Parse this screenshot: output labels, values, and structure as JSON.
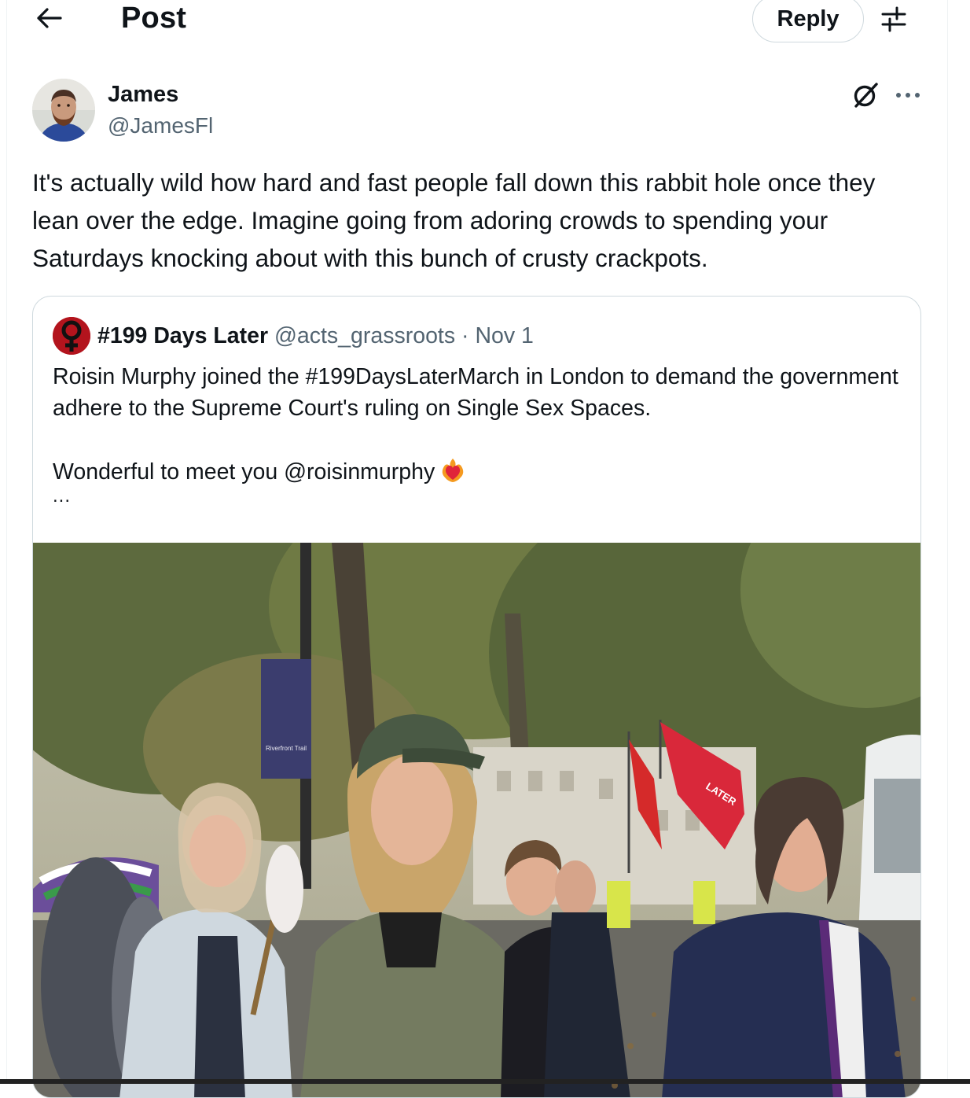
{
  "header": {
    "title": "Post",
    "reply_label": "Reply",
    "back_icon": "arrow-left-icon",
    "settings_icon": "sliders-icon"
  },
  "post": {
    "author_name": "James",
    "author_handle": "@JamesFl",
    "text": "It's actually wild how hard and fast people fall down this rabbit hole once they lean over the edge. Imagine going from adoring crowds to spending your Saturdays knocking about with this bunch of crusty crackpots."
  },
  "quote": {
    "name": "#199 Days Later",
    "handle": "@acts_grassroots",
    "separator": "·",
    "date": "Nov 1",
    "text_line1": "Roisin Murphy joined the #199DaysLaterMarch in London to demand the government adhere to the Supreme Court's ruling on Single Sex Spaces.",
    "text_line2": "Wonderful to meet you @roisinmurphy",
    "emoji": "heart-on-fire-icon",
    "ellipsis": "...",
    "photo": "photo-march-london",
    "banner_text": "Riverfront Trail",
    "flag_text": "LATER"
  },
  "colors": {
    "text_primary": "#0f1419",
    "text_secondary": "#536471",
    "border": "#cfd9de",
    "quote_avatar_bg": "#b3141d"
  }
}
